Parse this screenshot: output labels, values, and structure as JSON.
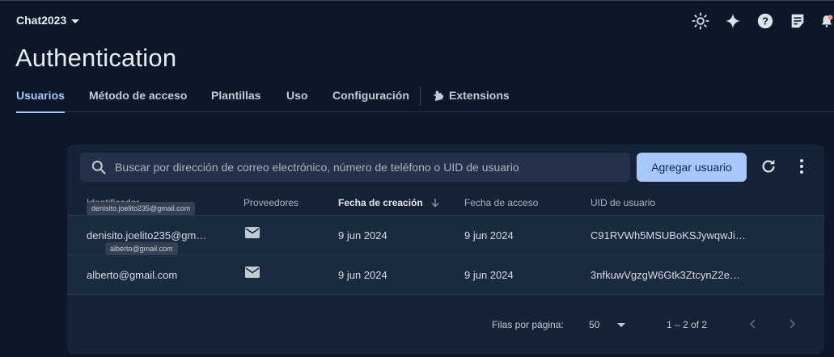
{
  "header": {
    "project_name": "Chat2023",
    "title": "Authentication",
    "icons": [
      "sun-icon",
      "sparkle-icon",
      "help-icon",
      "notes-icon",
      "notifications-icon"
    ]
  },
  "tabs": [
    {
      "label": "Usuarios",
      "active": true
    },
    {
      "label": "Método de acceso"
    },
    {
      "label": "Plantillas"
    },
    {
      "label": "Uso"
    },
    {
      "label": "Configuración"
    },
    {
      "label": "Extensions",
      "icon": "extension-icon"
    }
  ],
  "toolbar": {
    "search_placeholder": "Buscar por dirección de correo electrónico, número de teléfono o UID de usuario",
    "add_user_label": "Agregar usuario"
  },
  "table": {
    "columns": [
      "Identificador",
      "Proveedores",
      "Fecha de creación",
      "Fecha de acceso",
      "UID de usuario"
    ],
    "sorted_column": "Fecha de creación",
    "rows": [
      {
        "identifier": "denisito.joelito235@gm…",
        "provider": "email-icon",
        "created": "9 jun 2024",
        "accessed": "9 jun 2024",
        "uid": "C91RVWh5MSUBoKSJywqwJi…",
        "tooltip": "denisito.joelito235@gmail.com"
      },
      {
        "identifier": "alberto@gmail.com",
        "provider": "email-icon",
        "created": "9 jun 2024",
        "accessed": "9 jun 2024",
        "uid": "3nfkuwVgzgW6Gtk3ZtcynZ2e…",
        "tooltip": "alberto@gmail.com"
      }
    ]
  },
  "pagination": {
    "rows_per_page_label": "Filas por página:",
    "rows_per_page": "50",
    "range": "1 – 2 of 2"
  },
  "colors": {
    "background": "#0c1829",
    "card": "#152336",
    "accent": "#a8c7fa"
  }
}
